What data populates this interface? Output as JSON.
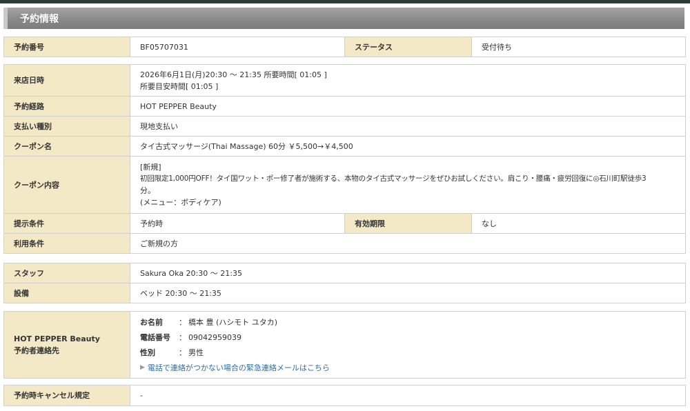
{
  "header": {
    "title": "予約情報"
  },
  "reservation": {
    "number_label": "予約番号",
    "number": "BF05707031",
    "status_label": "ステータス",
    "status": "受付待ち"
  },
  "visit": {
    "datetime_label": "来店日時",
    "datetime_line1": "2026年6月1日(月)20:30 〜 21:35 所要時間[ 01:05 ]",
    "datetime_line2": "所要目安時間[ 01:05 ]",
    "route_label": "予約経路",
    "route": "HOT PEPPER Beauty",
    "payment_label": "支払い種別",
    "payment": "現地支払い",
    "coupon_name_label": "クーポン名",
    "coupon_name": "タイ古式マッサージ(Thai Massage)  60分  ￥5,500→￥4,500",
    "coupon_content_label": "クーポン内容",
    "coupon_content_line1": "[新規]",
    "coupon_content_line2": "初回限定1,000円OFF！タイ国ワット・ポー修了者が施術する、本物のタイ古式マッサージをぜひお試しください。肩こり・腰痛・疲労回復に◎石川町駅徒歩3",
    "coupon_content_line3": "分。",
    "coupon_content_line4": "(メニュー：ボディケア)",
    "present_label": "提示条件",
    "present": "予約時",
    "expiry_label": "有効期限",
    "expiry": "なし",
    "usage_label": "利用条件",
    "usage": "ご新規の方"
  },
  "staff": {
    "staff_label": "スタッフ",
    "staff": "Sakura  Oka  20:30 〜 21:35",
    "equipment_label": "設備",
    "equipment": "ベッド  20:30 〜 21:35"
  },
  "contact": {
    "label_line1": "HOT PEPPER Beauty",
    "label_line2": "予約者連絡先",
    "name_key": "お名前",
    "name": "橋本 豊 (ハシモト ユタカ)",
    "phone_key": "電話番号",
    "phone": "09042959039",
    "gender_key": "性別",
    "gender": "男性",
    "colon": "：",
    "emergency_link": "電話で連絡がつかない場合の緊急連絡メールはこちら"
  },
  "cancel": {
    "label": "予約時キャンセル規定",
    "value": "-"
  }
}
